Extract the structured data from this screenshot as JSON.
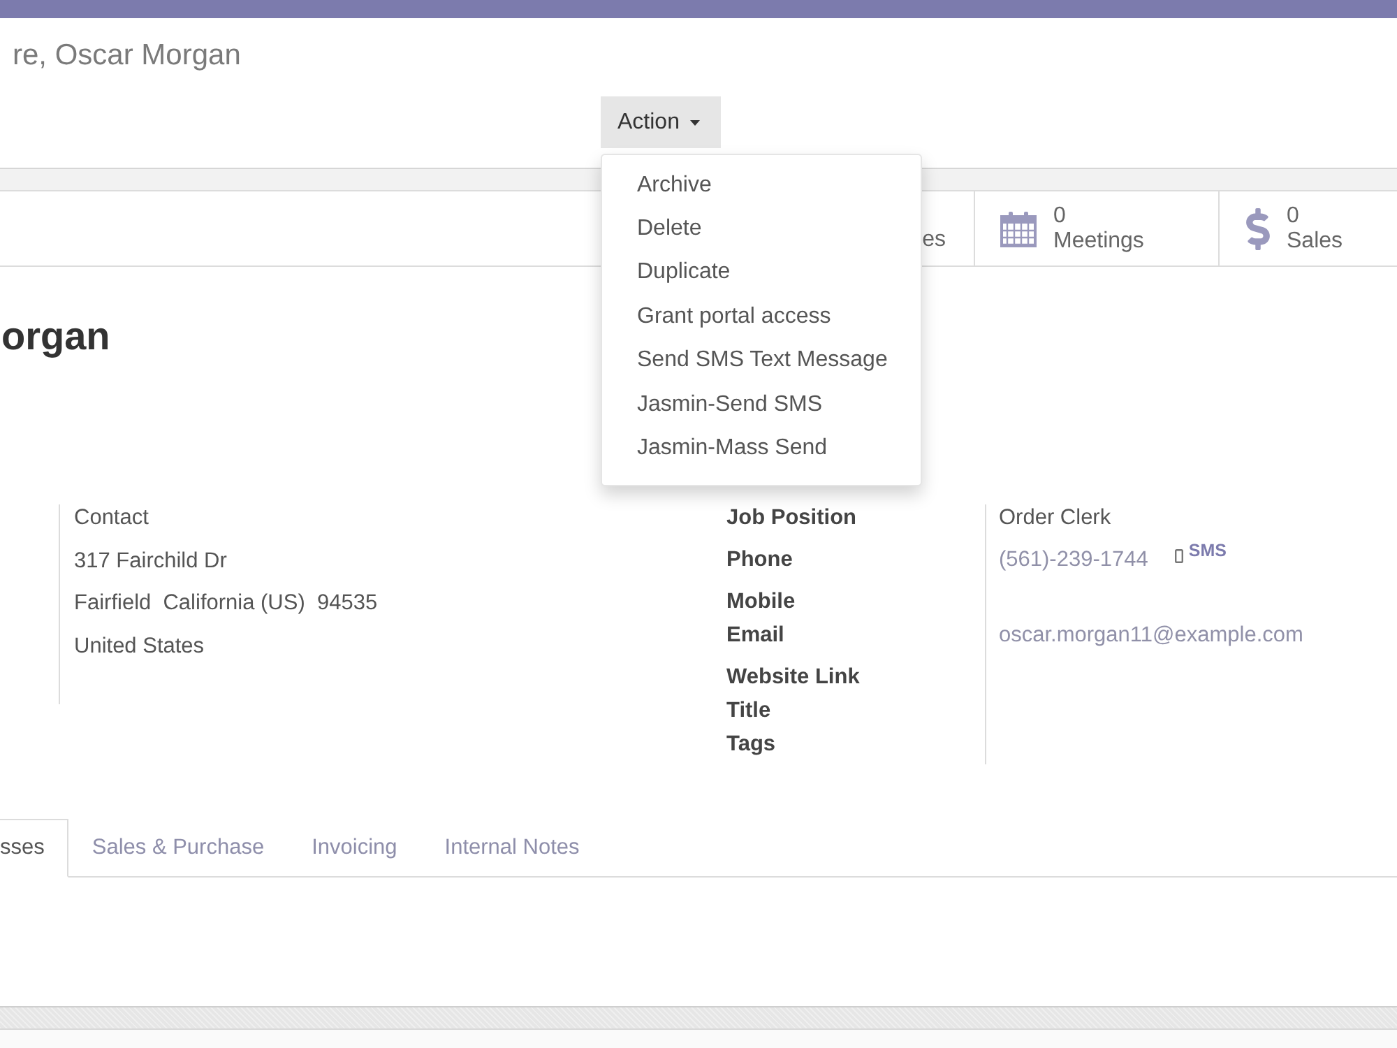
{
  "breadcrumb": "re, Oscar Morgan",
  "action_menu": {
    "label": "Action",
    "expanded": true,
    "items": [
      "Archive",
      "Delete",
      "Duplicate",
      "Grant portal access",
      "Send SMS Text Message",
      "Jasmin-Send SMS",
      "Jasmin-Mass Send"
    ]
  },
  "stat_buttons": [
    {
      "kind": "plain",
      "label": "es"
    },
    {
      "kind": "calendar",
      "value": "0",
      "label": "Meetings"
    },
    {
      "kind": "dollar",
      "value": "0",
      "label": "Sales"
    }
  ],
  "partner_name": "organ",
  "address": {
    "type": "Contact",
    "lines": [
      "317 Fairchild Dr",
      "Fairfield  California (US)  94535",
      "United States"
    ]
  },
  "fields": [
    {
      "kind": "text",
      "label": "Job Position",
      "value": "Order Clerk"
    },
    {
      "kind": "phone",
      "label": "Phone",
      "value": "(561)-239-1744",
      "sms": "SMS"
    },
    {
      "kind": "text",
      "label": "Mobile"
    },
    {
      "kind": "email",
      "label": "Email",
      "value": "oscar.morgan11@example.com"
    },
    {
      "kind": "text",
      "label": "Website Link"
    },
    {
      "kind": "text",
      "label": "Title"
    },
    {
      "kind": "text",
      "label": "Tags"
    }
  ],
  "tabs": [
    {
      "label": "sses",
      "selected": true
    },
    {
      "label": "Sales & Purchase",
      "selected": false
    },
    {
      "label": "Invoicing",
      "selected": false
    },
    {
      "label": "Internal Notes",
      "selected": false
    }
  ]
}
